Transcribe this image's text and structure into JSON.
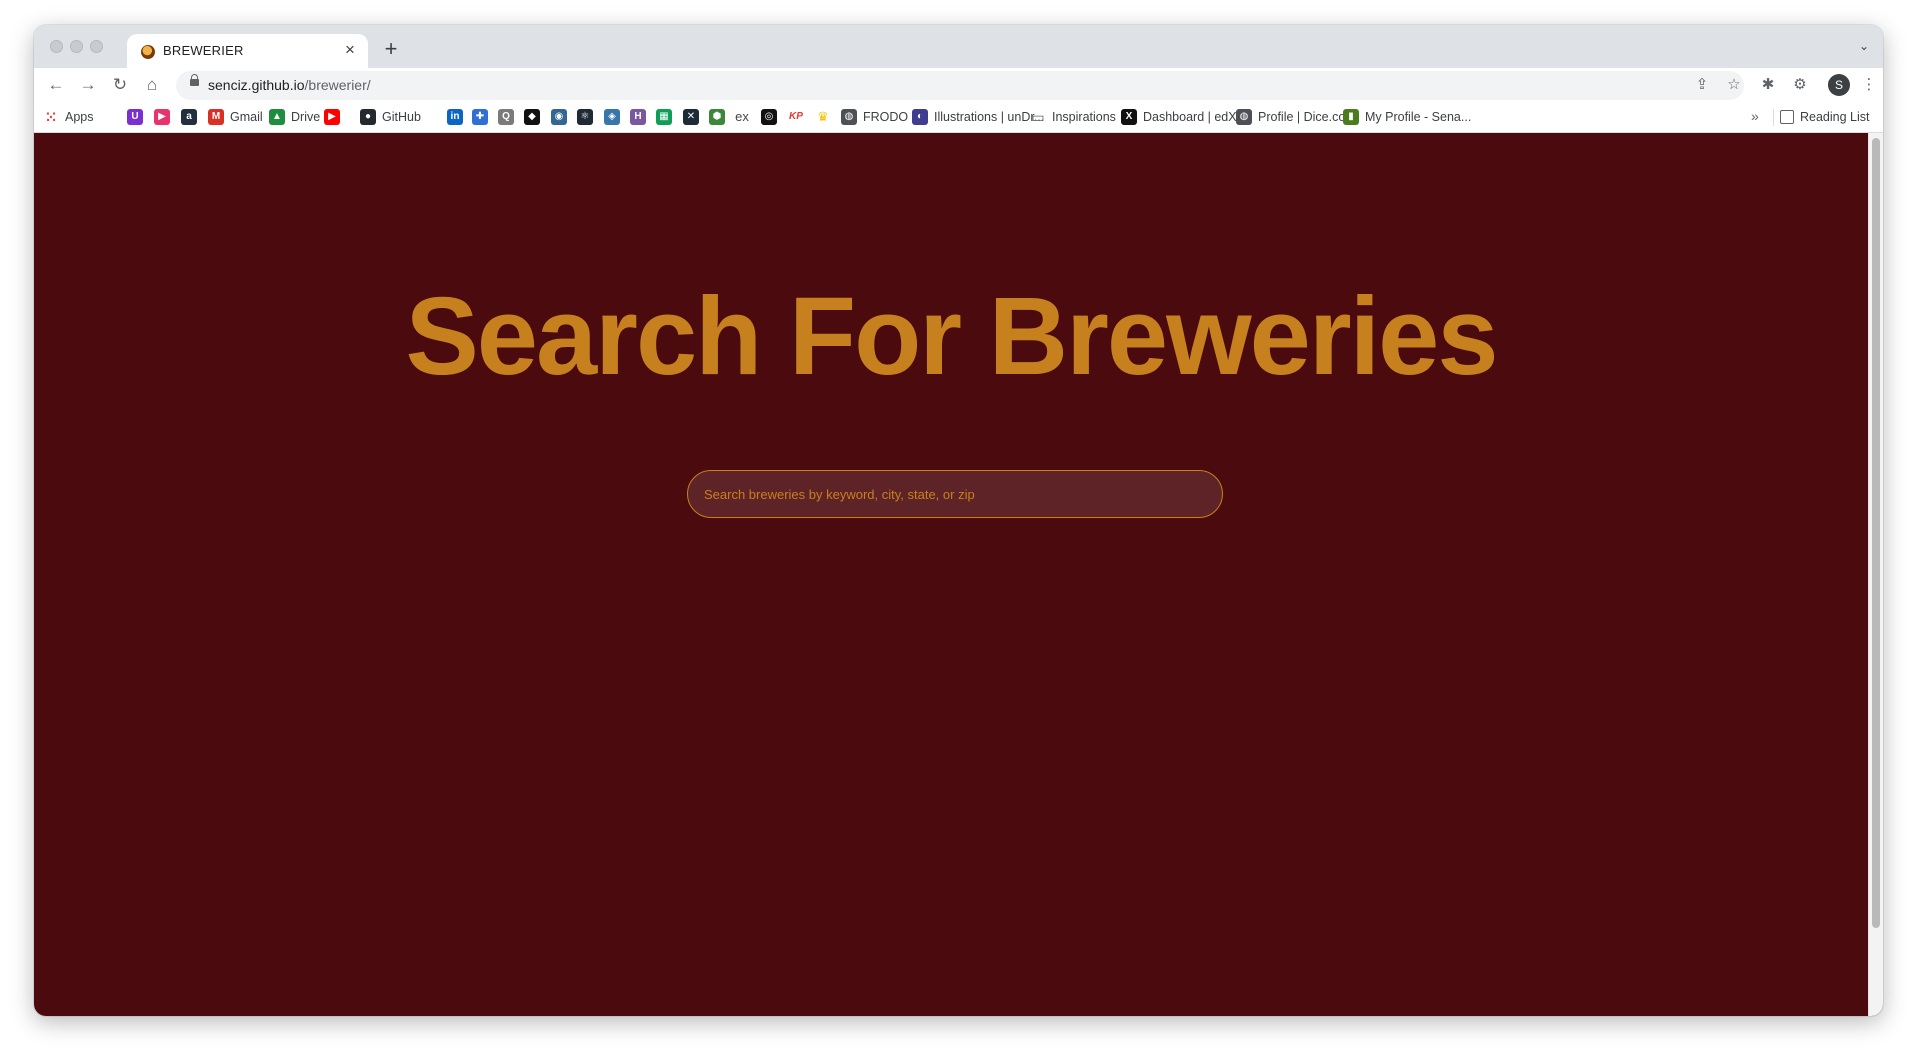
{
  "browser": {
    "tab": {
      "title": "BREWERIER",
      "close": "×",
      "new_tab": "+"
    },
    "tab_search": "⌄",
    "toolbar": {
      "back": "←",
      "forward": "→",
      "reload": "↻",
      "home": "⌂"
    },
    "address": {
      "host": "senciz.github.io",
      "path": "/brewerier/"
    },
    "omnibox_icons": {
      "share": "⇪",
      "bookmark_star": "☆"
    },
    "tool_icons": {
      "extension_bug": "✱",
      "extensions": "⚙",
      "media": "≡",
      "menu": "⋮"
    },
    "profile_initial": "S",
    "bookmarks": [
      {
        "label": "Apps",
        "icon": "apps-grid-icon",
        "color": "#1a73e8"
      },
      {
        "label": "",
        "icon": "u-circle-icon",
        "color": "#7b2fd1"
      },
      {
        "label": "",
        "icon": "play-circle-icon",
        "color": "#e8336d"
      },
      {
        "label": "",
        "icon": "amazon-icon",
        "color": "#232f3e"
      },
      {
        "label": "Gmail",
        "icon": "gmail-icon",
        "color": "#d93025"
      },
      {
        "label": "Drive",
        "icon": "drive-icon",
        "color": "#1e8e3e"
      },
      {
        "label": "",
        "icon": "youtube-icon",
        "color": "#ff0000"
      },
      {
        "label": "GitHub",
        "icon": "github-icon",
        "color": "#24292f"
      },
      {
        "label": "",
        "icon": "linkedin-icon",
        "color": "#0a66c2"
      },
      {
        "label": "",
        "icon": "puzzle-pieces-icon",
        "color": "#2f6fd6"
      },
      {
        "label": "",
        "icon": "magnifier-box-icon",
        "color": "#7a7a7a"
      },
      {
        "label": "",
        "icon": "codepen-icon",
        "color": "#111111"
      },
      {
        "label": "",
        "icon": "postgres-elephant-icon",
        "color": "#336791"
      },
      {
        "label": "",
        "icon": "react-atom-icon",
        "color": "#1f2a36"
      },
      {
        "label": "",
        "icon": "python-icon",
        "color": "#3776ab"
      },
      {
        "label": "",
        "icon": "heroku-icon",
        "color": "#79589f"
      },
      {
        "label": "",
        "icon": "sheets-icon",
        "color": "#0f9d58"
      },
      {
        "label": "",
        "icon": "x-box-icon",
        "color": "#1c2b3a"
      },
      {
        "label": "",
        "icon": "nodejs-hex-icon",
        "color": "#3c873a"
      },
      {
        "label": "",
        "icon": "ex-icon",
        "color": "#444444"
      },
      {
        "label": "",
        "icon": "spiral-icon",
        "color": "#111111"
      },
      {
        "label": "",
        "icon": "kp-icon",
        "color": "#e53935"
      },
      {
        "label": "",
        "icon": "crown-icon",
        "color": "#f2c200"
      },
      {
        "label": "FRODO",
        "icon": "globe-icon",
        "color": "#4d5156"
      },
      {
        "label": "Illustrations | unDr...",
        "icon": "undraw-icon",
        "color": "#3f3d8f"
      },
      {
        "label": "Inspirations",
        "icon": "folder-icon",
        "color": "#5f6368"
      },
      {
        "label": "Dashboard | edX",
        "icon": "edx-icon",
        "color": "#111111"
      },
      {
        "label": "Profile | Dice.com",
        "icon": "globe-icon",
        "color": "#4d5156"
      },
      {
        "label": "My Profile - Sena...",
        "icon": "mic-green-icon",
        "color": "#4a7c1f"
      }
    ],
    "bookmarks_overflow": "»",
    "reading_list": "Reading List"
  },
  "page": {
    "background": "#4a0a0e",
    "accent": "#c7801e",
    "title": "Search For Breweries",
    "search_placeholder": "Search breweries by keyword, city, state, or zip"
  }
}
